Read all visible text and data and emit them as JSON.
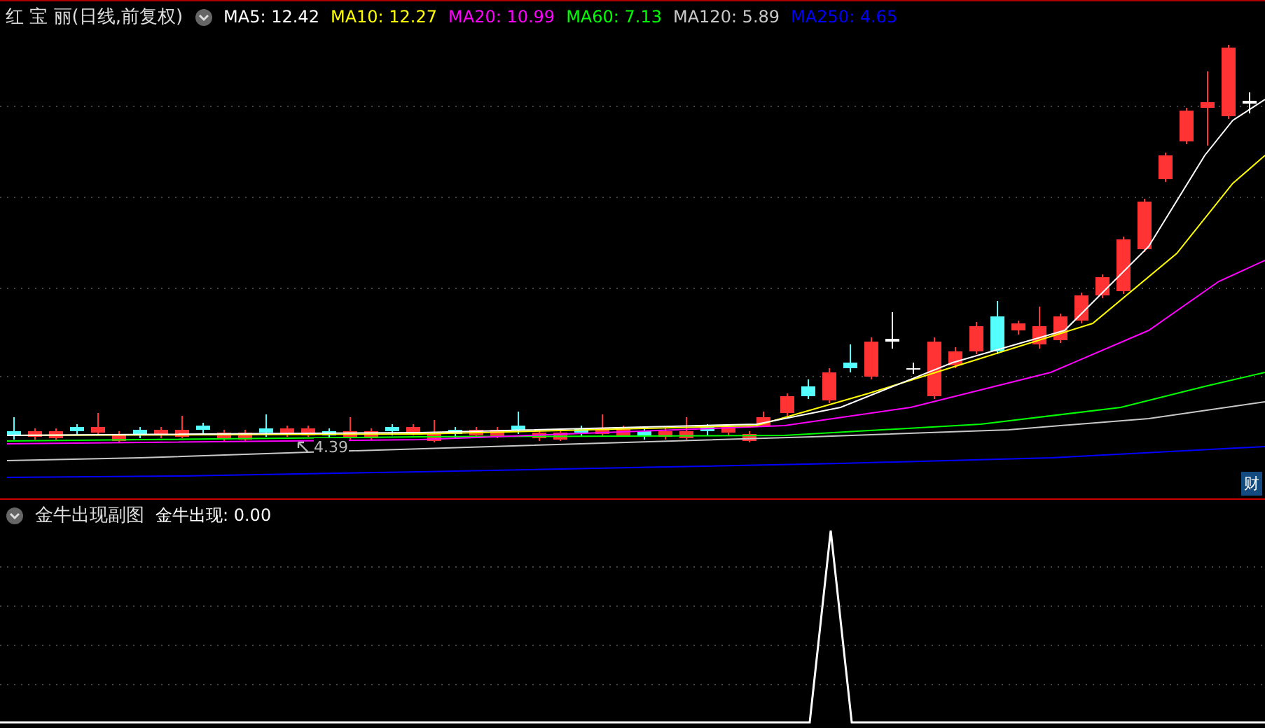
{
  "main_chart": {
    "title": "红 宝 丽(日线,前复权)",
    "indicators": [
      {
        "label": "MA5: 12.42",
        "color": "#ffffff"
      },
      {
        "label": "MA10: 12.27",
        "color": "#ffff00"
      },
      {
        "label": "MA20: 10.99",
        "color": "#ff00ff"
      },
      {
        "label": "MA60: 7.13",
        "color": "#00ff00"
      },
      {
        "label": "MA120: 5.89",
        "color": "#c8c8c8"
      },
      {
        "label": "MA250: 4.65",
        "color": "#0000ff"
      }
    ],
    "low_marker": "4.39",
    "badge": "财"
  },
  "sub_chart": {
    "title": "金牛出现副图",
    "indicators": [
      {
        "label": "金牛出现: 0.00",
        "color": "#ffffff"
      }
    ]
  }
}
